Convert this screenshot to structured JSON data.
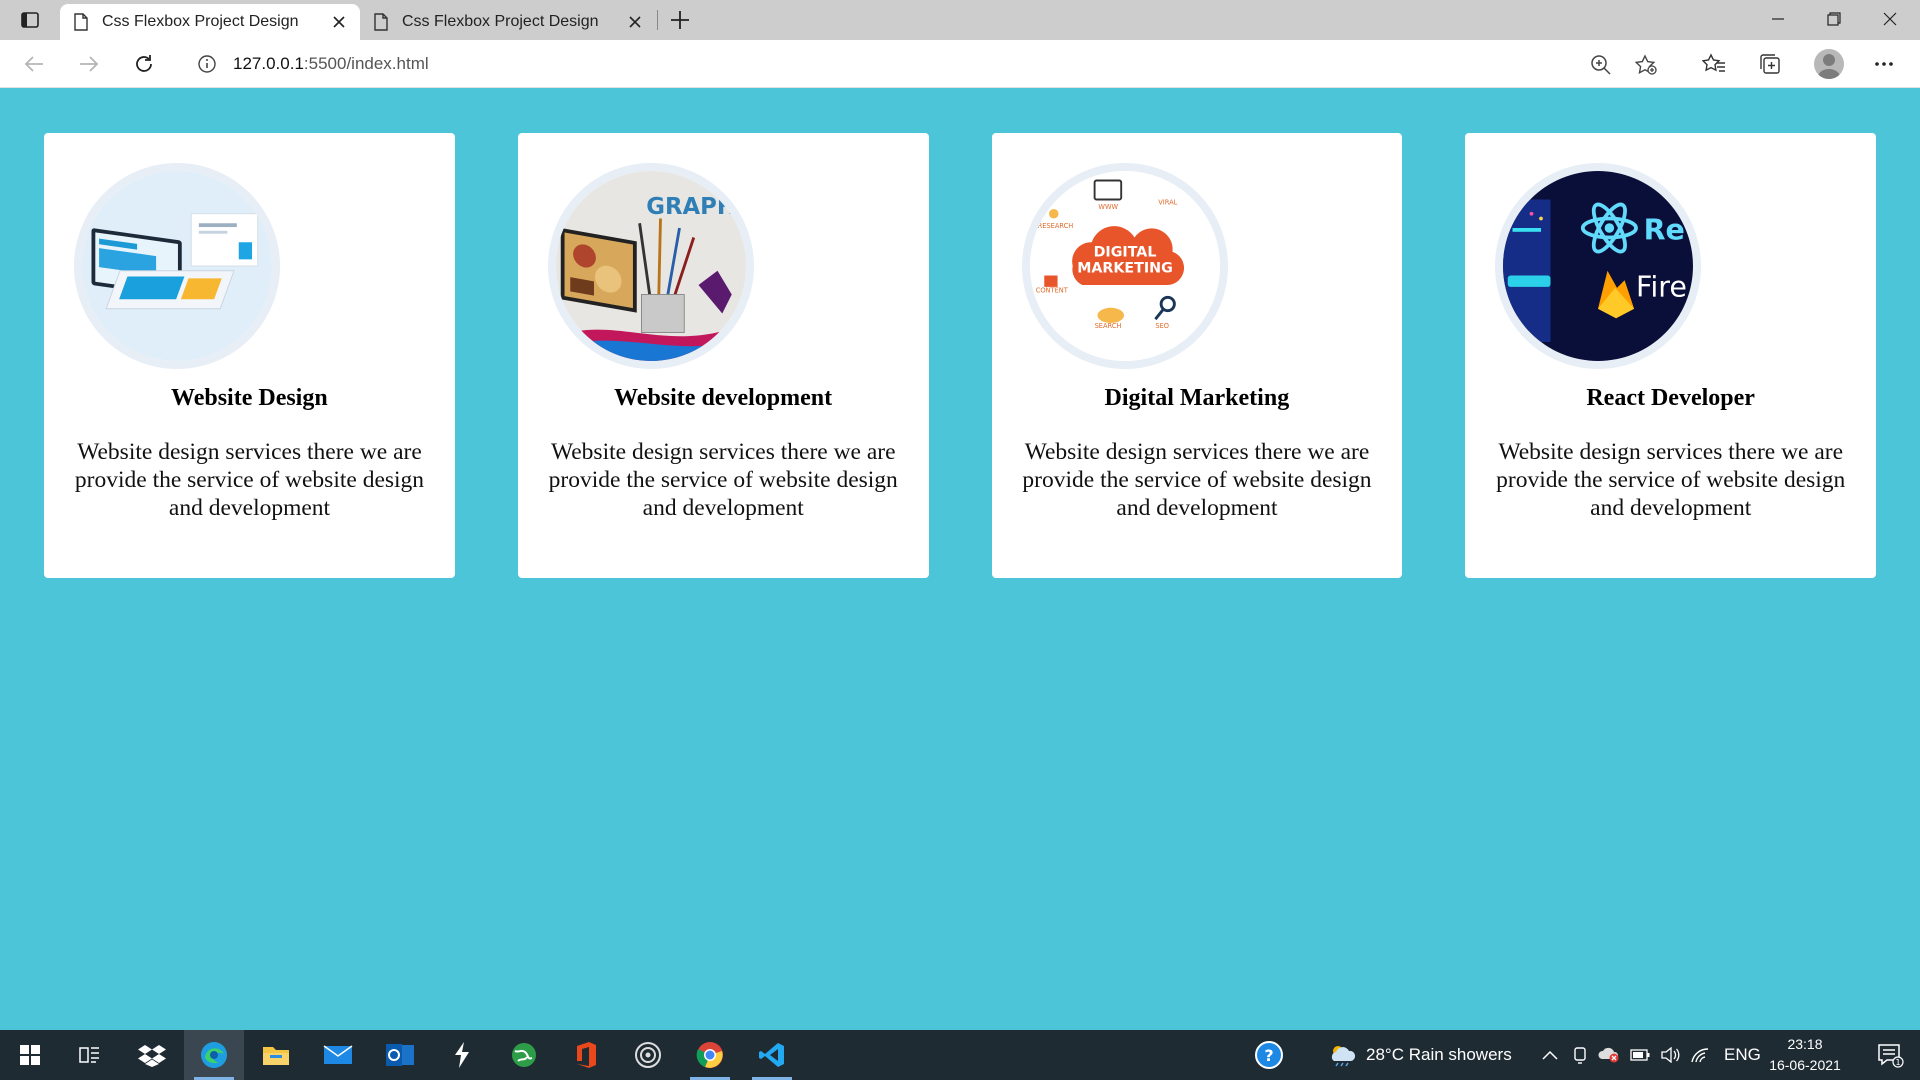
{
  "browser": {
    "tabs": [
      {
        "title": "Css Flexbox Project Design",
        "active": true
      },
      {
        "title": "Css Flexbox Project Design",
        "active": false
      }
    ],
    "url_host": "127.0.0.1",
    "url_rest": ":5500/index.html"
  },
  "page": {
    "background_color": "#4cc5d8",
    "cards": [
      {
        "title": "Website Design",
        "description": "Website design services there we are provide the service of website design and development",
        "image_icon": "laptop-mockup-image"
      },
      {
        "title": "Website development",
        "description": "Website design services there we are provide the service of website design and development",
        "image_icon": "graphic-design-brushes-image",
        "image_text": "GRAPHIC DESIGN"
      },
      {
        "title": "Digital Marketing",
        "description": "Website design services there we are provide the service of website design and development",
        "image_icon": "digital-marketing-cloud-image",
        "image_text_1": "DIGITAL",
        "image_text_2": "MARKETING",
        "image_labels": [
          "WWW",
          "VIRAL",
          "RESEARCH",
          "CONTENT",
          "SEARCH",
          "SEO"
        ]
      },
      {
        "title": "React Developer",
        "description": "Website design services there we are provide the service of website design and development",
        "image_icon": "react-firebase-image",
        "image_text_1": "Re",
        "image_text_2": "Fire"
      }
    ]
  },
  "taskbar": {
    "apps": [
      "windows-start-icon",
      "task-view-icon",
      "dropbox-icon",
      "edge-icon",
      "file-explorer-icon",
      "mail-icon",
      "outlook-icon",
      "sublime-icon",
      "network-globe-icon",
      "office-icon",
      "circle-app-icon",
      "chrome-icon",
      "vscode-icon"
    ],
    "weather": "28°C  Rain showers",
    "language": "ENG",
    "time": "23:18",
    "date": "16-06-2021",
    "notification_count": "1"
  }
}
